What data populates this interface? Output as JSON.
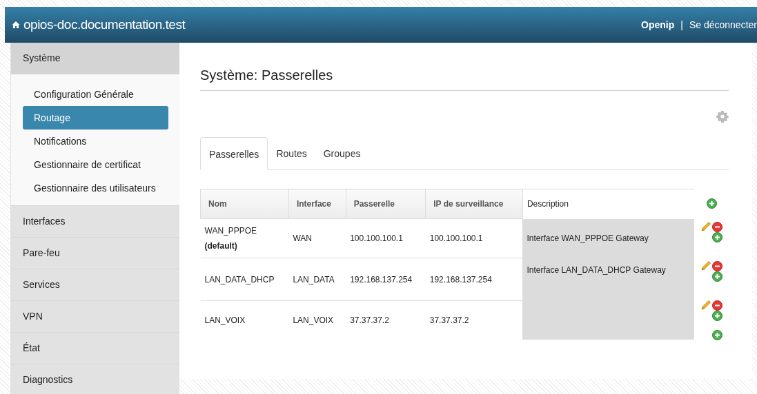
{
  "navbar": {
    "brand": "opios-doc.documentation.test",
    "user": "Openip",
    "separator": "|",
    "logout": "Se déconnecter"
  },
  "sidebar": {
    "sections": [
      {
        "label": "Système",
        "expanded": true,
        "items": [
          {
            "label": "Configuration Générale",
            "selected": false
          },
          {
            "label": "Routage",
            "selected": true
          },
          {
            "label": "Notifications",
            "selected": false
          },
          {
            "label": "Gestionnaire de certificat",
            "selected": false
          },
          {
            "label": "Gestionnaire des utilisateurs",
            "selected": false
          }
        ]
      },
      {
        "label": "Interfaces",
        "expanded": false
      },
      {
        "label": "Pare-feu",
        "expanded": false
      },
      {
        "label": "Services",
        "expanded": false
      },
      {
        "label": "VPN",
        "expanded": false
      },
      {
        "label": "État",
        "expanded": false
      },
      {
        "label": "Diagnostics",
        "expanded": false
      }
    ]
  },
  "page": {
    "title": "Système: Passerelles"
  },
  "tabs": [
    {
      "label": "Passerelles",
      "selected": true
    },
    {
      "label": "Routes",
      "selected": false
    },
    {
      "label": "Groupes",
      "selected": false
    }
  ],
  "table": {
    "columns": [
      "Nom",
      "Interface",
      "Passerelle",
      "IP de surveillance",
      "Description"
    ],
    "rows": [
      {
        "name": "WAN_PPPOE",
        "default_label": "(default)",
        "interface": "WAN",
        "gateway": "100.100.100.1",
        "monitor_ip": "100.100.100.1",
        "description": "Interface WAN_PPPOE Gateway"
      },
      {
        "name": "LAN_DATA_DHCP",
        "interface": "LAN_DATA",
        "gateway": "192.168.137.254",
        "monitor_ip": "192.168.137.254",
        "description": "Interface LAN_DATA_DHCP Gateway"
      },
      {
        "name": "LAN_VOIX",
        "interface": "LAN_VOIX",
        "gateway": "37.37.37.2",
        "monitor_ip": "37.37.37.2"
      }
    ]
  }
}
